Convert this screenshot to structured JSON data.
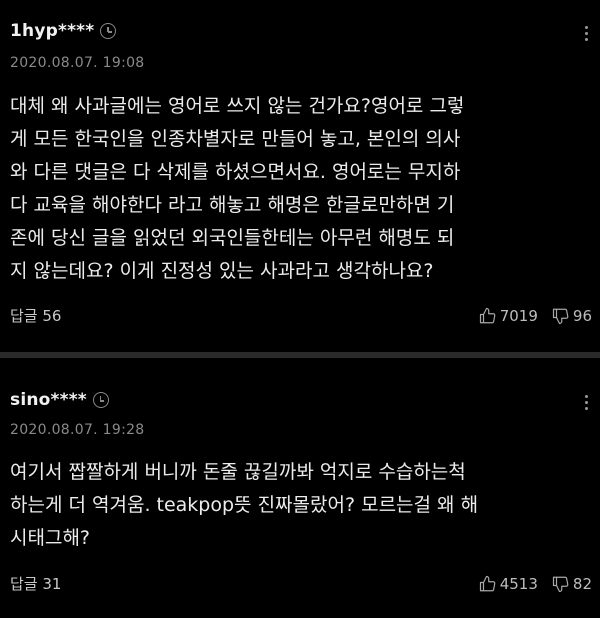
{
  "comments": [
    {
      "username": "1hyp****",
      "timestamp": "2020.08.07. 19:08",
      "lines": [
        "대체 왜 사과글에는 영어로 쓰지 않는 건가요?영어로 그렇",
        "게 모든 한국인을 인종차별자로 만들어 놓고, 본인의 의사",
        "와 다른 댓글은 다 삭제를 하셨으면서요. 영어로는 무지하",
        "다 교육을 해야한다 라고 해놓고 해명은 한글로만하면 기",
        "존에 당신 글을 읽었던 외국인들한테는 아무런 해명도 되",
        "지 않는데요? 이게 진정성 있는 사과라고 생각하나요?"
      ],
      "reply_label": "답글 56",
      "likes": "7019",
      "dislikes": "96"
    },
    {
      "username": "sino****",
      "timestamp": "2020.08.07. 19:28",
      "lines": [
        "여기서 짭짤하게 버니까 돈줄 끊길까봐 억지로 수습하는척",
        "하는게 더 역겨움. teakpop뜻 진짜몰랐어? 모르는걸 왜 해",
        "시태그해?"
      ],
      "reply_label": "답글 31",
      "likes": "4513",
      "dislikes": "82"
    }
  ],
  "icons": {
    "timestamp": "clock-icon",
    "menu": "more-vertical-icon",
    "like": "thumbs-up-icon",
    "dislike": "thumbs-down-icon"
  },
  "colors": {
    "background": "#000000",
    "text": "#ececec",
    "muted": "#8a8a8a",
    "divider": "#2a2a2a"
  }
}
